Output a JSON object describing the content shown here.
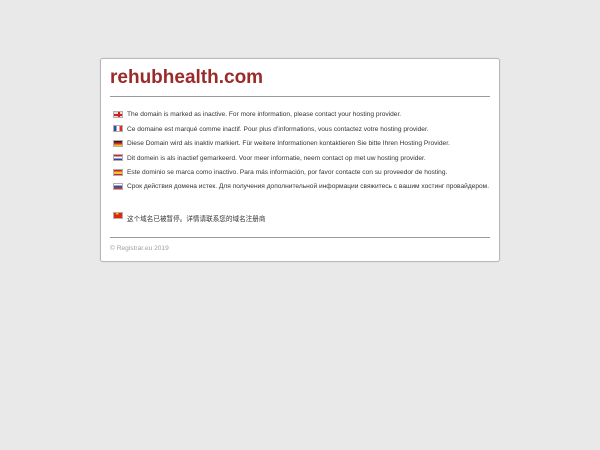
{
  "page": {
    "title": "rehubhealth.com",
    "copyright": "© Registrar.eu 2019"
  },
  "messages": [
    {
      "flag": "uk-flag-icon",
      "text": "The domain is marked as inactive. For more information, please contact your hosting provider."
    },
    {
      "flag": "france-flag-icon",
      "text": "Ce domaine est marqué comme inactif. Pour plus d’informations, vous contactez votre hosting provider."
    },
    {
      "flag": "germany-flag-icon",
      "text": "Diese Domain wird als inaktiv markiert. Für weitere Informationen kontaktieren Sie bitte Ihren Hosting Provider."
    },
    {
      "flag": "netherlands-flag-icon",
      "text": "Dit domein is als inactief gemarkeerd. Voor meer informatie, neem contact op met uw hosting provider."
    },
    {
      "flag": "spain-flag-icon",
      "text": "Este dominio se marca como inactivo. Para más información, por favor contacte con su proveedor de hosting."
    },
    {
      "flag": "russia-flag-icon",
      "text": "Срок действия домена истек. Для получения дополнительной информации свяжитесь с вашим хостинг провайдером."
    },
    {
      "flag": "china-flag-icon",
      "text": "这个域名已被暂停。详情请联系您的域名注册商"
    }
  ],
  "colors": {
    "background": "#e9e9e9",
    "title": "#9b2a2a",
    "text": "#333333",
    "muted": "#a0a0a0"
  }
}
